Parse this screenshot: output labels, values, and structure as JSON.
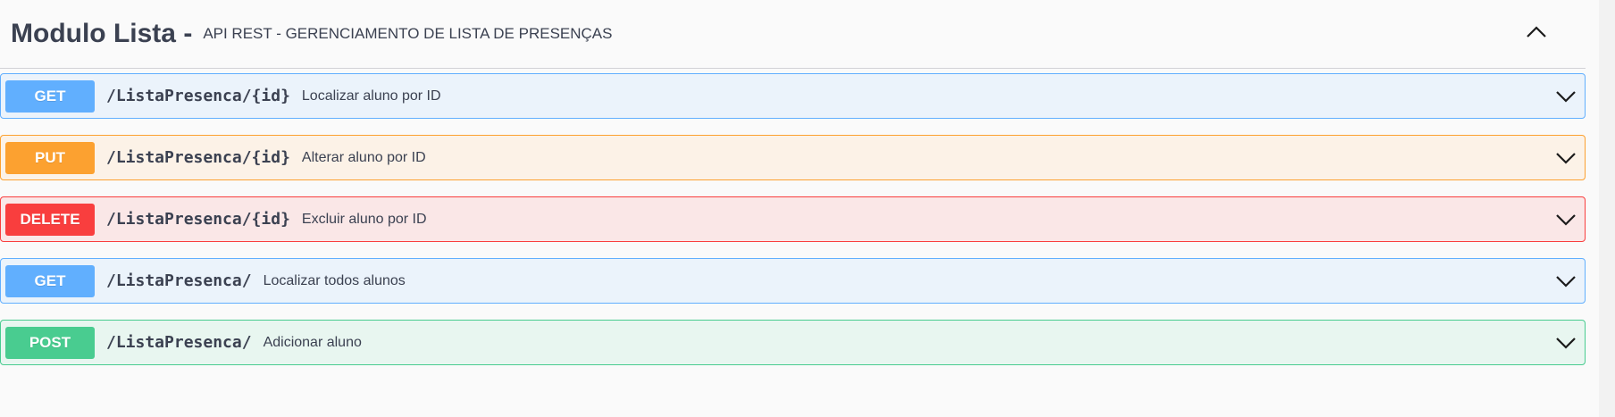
{
  "tag": {
    "title": "Modulo Lista -",
    "description": "API REST - GERENCIAMENTO DE LISTA DE PRESENÇAS",
    "toggle_icon": "chevron-up-icon"
  },
  "operations": [
    {
      "method": "GET",
      "path": "/ListaPresenca/{id}",
      "summary": "Localizar aluno por ID",
      "color": "#61affe"
    },
    {
      "method": "PUT",
      "path": "/ListaPresenca/{id}",
      "summary": "Alterar aluno por ID",
      "color": "#fca130"
    },
    {
      "method": "DELETE",
      "path": "/ListaPresenca/{id}",
      "summary": "Excluir aluno por ID",
      "color": "#f93e3e"
    },
    {
      "method": "GET",
      "path": "/ListaPresenca/",
      "summary": "Localizar todos alunos",
      "color": "#61affe"
    },
    {
      "method": "POST",
      "path": "/ListaPresenca/",
      "summary": "Adicionar aluno",
      "color": "#49cc90"
    }
  ],
  "icons": {
    "row_toggle": "chevron-down-icon"
  }
}
